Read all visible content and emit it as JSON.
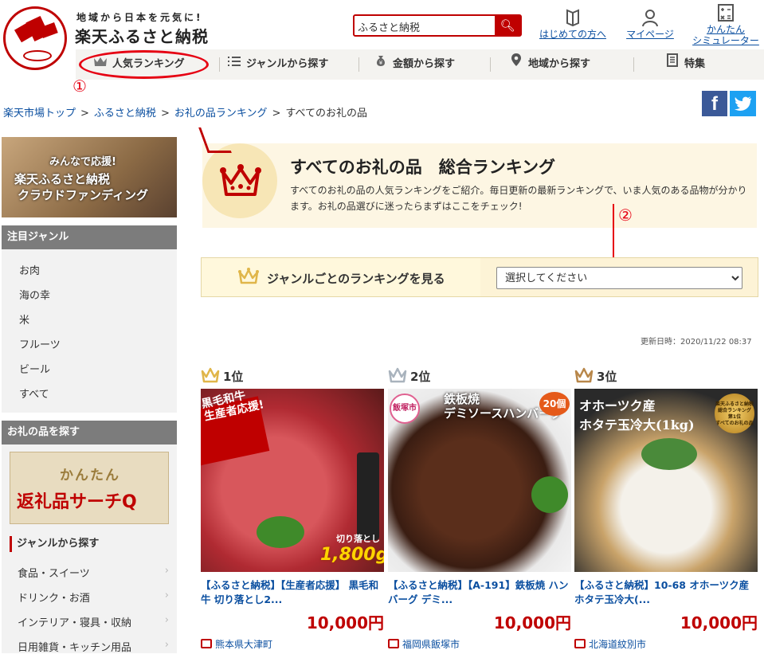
{
  "header": {
    "tagline": "地域から日本を元気に!",
    "brand": "楽天ふるさと納税",
    "search_value": "ふるさと納税",
    "links": [
      {
        "label": "はじめての方へ",
        "icon": "book-icon"
      },
      {
        "label": "マイページ",
        "icon": "user-icon"
      },
      {
        "label": "かんたん\nシミュレーター",
        "icon": "calculator-icon"
      }
    ]
  },
  "nav": {
    "items": [
      {
        "label": "人気ランキング",
        "icon": "crown-icon"
      },
      {
        "label": "ジャンルから探す",
        "icon": "list-icon"
      },
      {
        "label": "金額から探す",
        "icon": "money-bag-icon"
      },
      {
        "label": "地域から探す",
        "icon": "map-pin-icon"
      },
      {
        "label": "特集",
        "icon": "document-icon"
      }
    ]
  },
  "annotations": {
    "one": "①",
    "two": "②"
  },
  "breadcrumb": {
    "items": [
      "楽天市場トップ",
      "ふるさと納税",
      "お礼の品ランキング"
    ],
    "current": "すべてのお礼の品",
    "sep": ">"
  },
  "sidebar": {
    "banner": {
      "line1": "みんなで応援!",
      "line2": "楽天ふるさと納税",
      "line3": "クラウドファンディング"
    },
    "featured_title": "注目ジャンル",
    "featured": [
      "お肉",
      "海の幸",
      "米",
      "フルーツ",
      "ビール",
      "すべて"
    ],
    "search_title": "お礼の品を探す",
    "search_banner": {
      "line1": "かんたん",
      "line2": "返礼品サーチQ"
    },
    "genre_title": "ジャンルから探す",
    "genres": [
      "食品・スイーツ",
      "ドリンク・お酒",
      "インテリア・寝具・収納",
      "日用雑貨・キッチン用品"
    ]
  },
  "hero": {
    "title": "すべてのお礼の品　総合ランキング",
    "description": "すべてのお礼の品の人気ランキングをご紹介。毎日更新の最新ランキングで、いま人気のある品物が分かります。お礼の品選びに迷ったらまずはここをチェック!"
  },
  "genre_select": {
    "label": "ジャンルごとのランキングを見る",
    "selected": "選択してください"
  },
  "updated": "更新日時：2020/11/22 08:37",
  "ranking": [
    {
      "rank": "1位",
      "crown_color": "#e0b64a",
      "name": "【ふるさと納税】【生産者応援】 黒毛和牛 切り落とし2...",
      "price": "10,000円",
      "place": "熊本県大津町",
      "img_text": {
        "band": "黒毛和牛\n生産者応援!",
        "big": "1,800g",
        "small": "切り落とし"
      }
    },
    {
      "rank": "2位",
      "crown_color": "#a9b3bd",
      "name": "【ふるさと納税】【A-191】鉄板焼 ハンバーグ デミ...",
      "price": "10,000円",
      "place": "福岡県飯塚市",
      "img_text": {
        "title": "鉄板焼\nデミソースハンバーグ",
        "badge": "20個",
        "city": "飯塚市"
      }
    },
    {
      "rank": "3位",
      "crown_color": "#b8874a",
      "name": "【ふるさと納税】10-68 オホーツク産ホタテ玉冷大(...",
      "price": "10,000円",
      "place": "北海道紋別市",
      "img_text": {
        "title": "オホーツク産\nホタテ玉冷大(1kg)",
        "medal": "楽天ふるさと納税\n総合ランキング\n第1位\nすべてのお礼の品"
      }
    }
  ],
  "social": {
    "facebook": "f",
    "twitter": "t"
  },
  "colors": {
    "brand_red": "#bf0000",
    "annotation_red": "#e60012",
    "link_blue": "#0b4fa0"
  }
}
